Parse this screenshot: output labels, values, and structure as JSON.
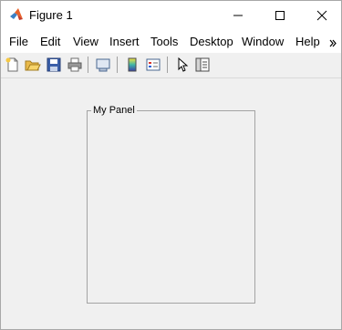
{
  "window": {
    "title": "Figure 1",
    "controls": {
      "minimize": "minimize",
      "maximize": "maximize",
      "close": "close"
    }
  },
  "menubar": {
    "items": [
      "File",
      "Edit",
      "View",
      "Insert",
      "Tools",
      "Desktop",
      "Window",
      "Help"
    ],
    "overflow_icon": "chevron-right-double-icon"
  },
  "toolbar": {
    "buttons": [
      {
        "name": "new-figure",
        "icon": "new-file-icon"
      },
      {
        "name": "open-file",
        "icon": "open-folder-icon"
      },
      {
        "name": "save-figure",
        "icon": "save-disk-icon"
      },
      {
        "name": "print-figure",
        "icon": "printer-icon"
      },
      {
        "name": "link-plot",
        "icon": "link-plot-icon"
      },
      {
        "name": "insert-colorbar",
        "icon": "colorbar-icon"
      },
      {
        "name": "insert-legend",
        "icon": "legend-icon"
      },
      {
        "name": "edit-plot",
        "icon": "arrow-pointer-icon"
      },
      {
        "name": "property-inspector",
        "icon": "inspector-icon"
      }
    ]
  },
  "panel": {
    "title": "My Panel"
  },
  "colors": {
    "background": "#f0f0f0",
    "titlebar": "#ffffff",
    "panel_border": "#a3a3a3"
  }
}
